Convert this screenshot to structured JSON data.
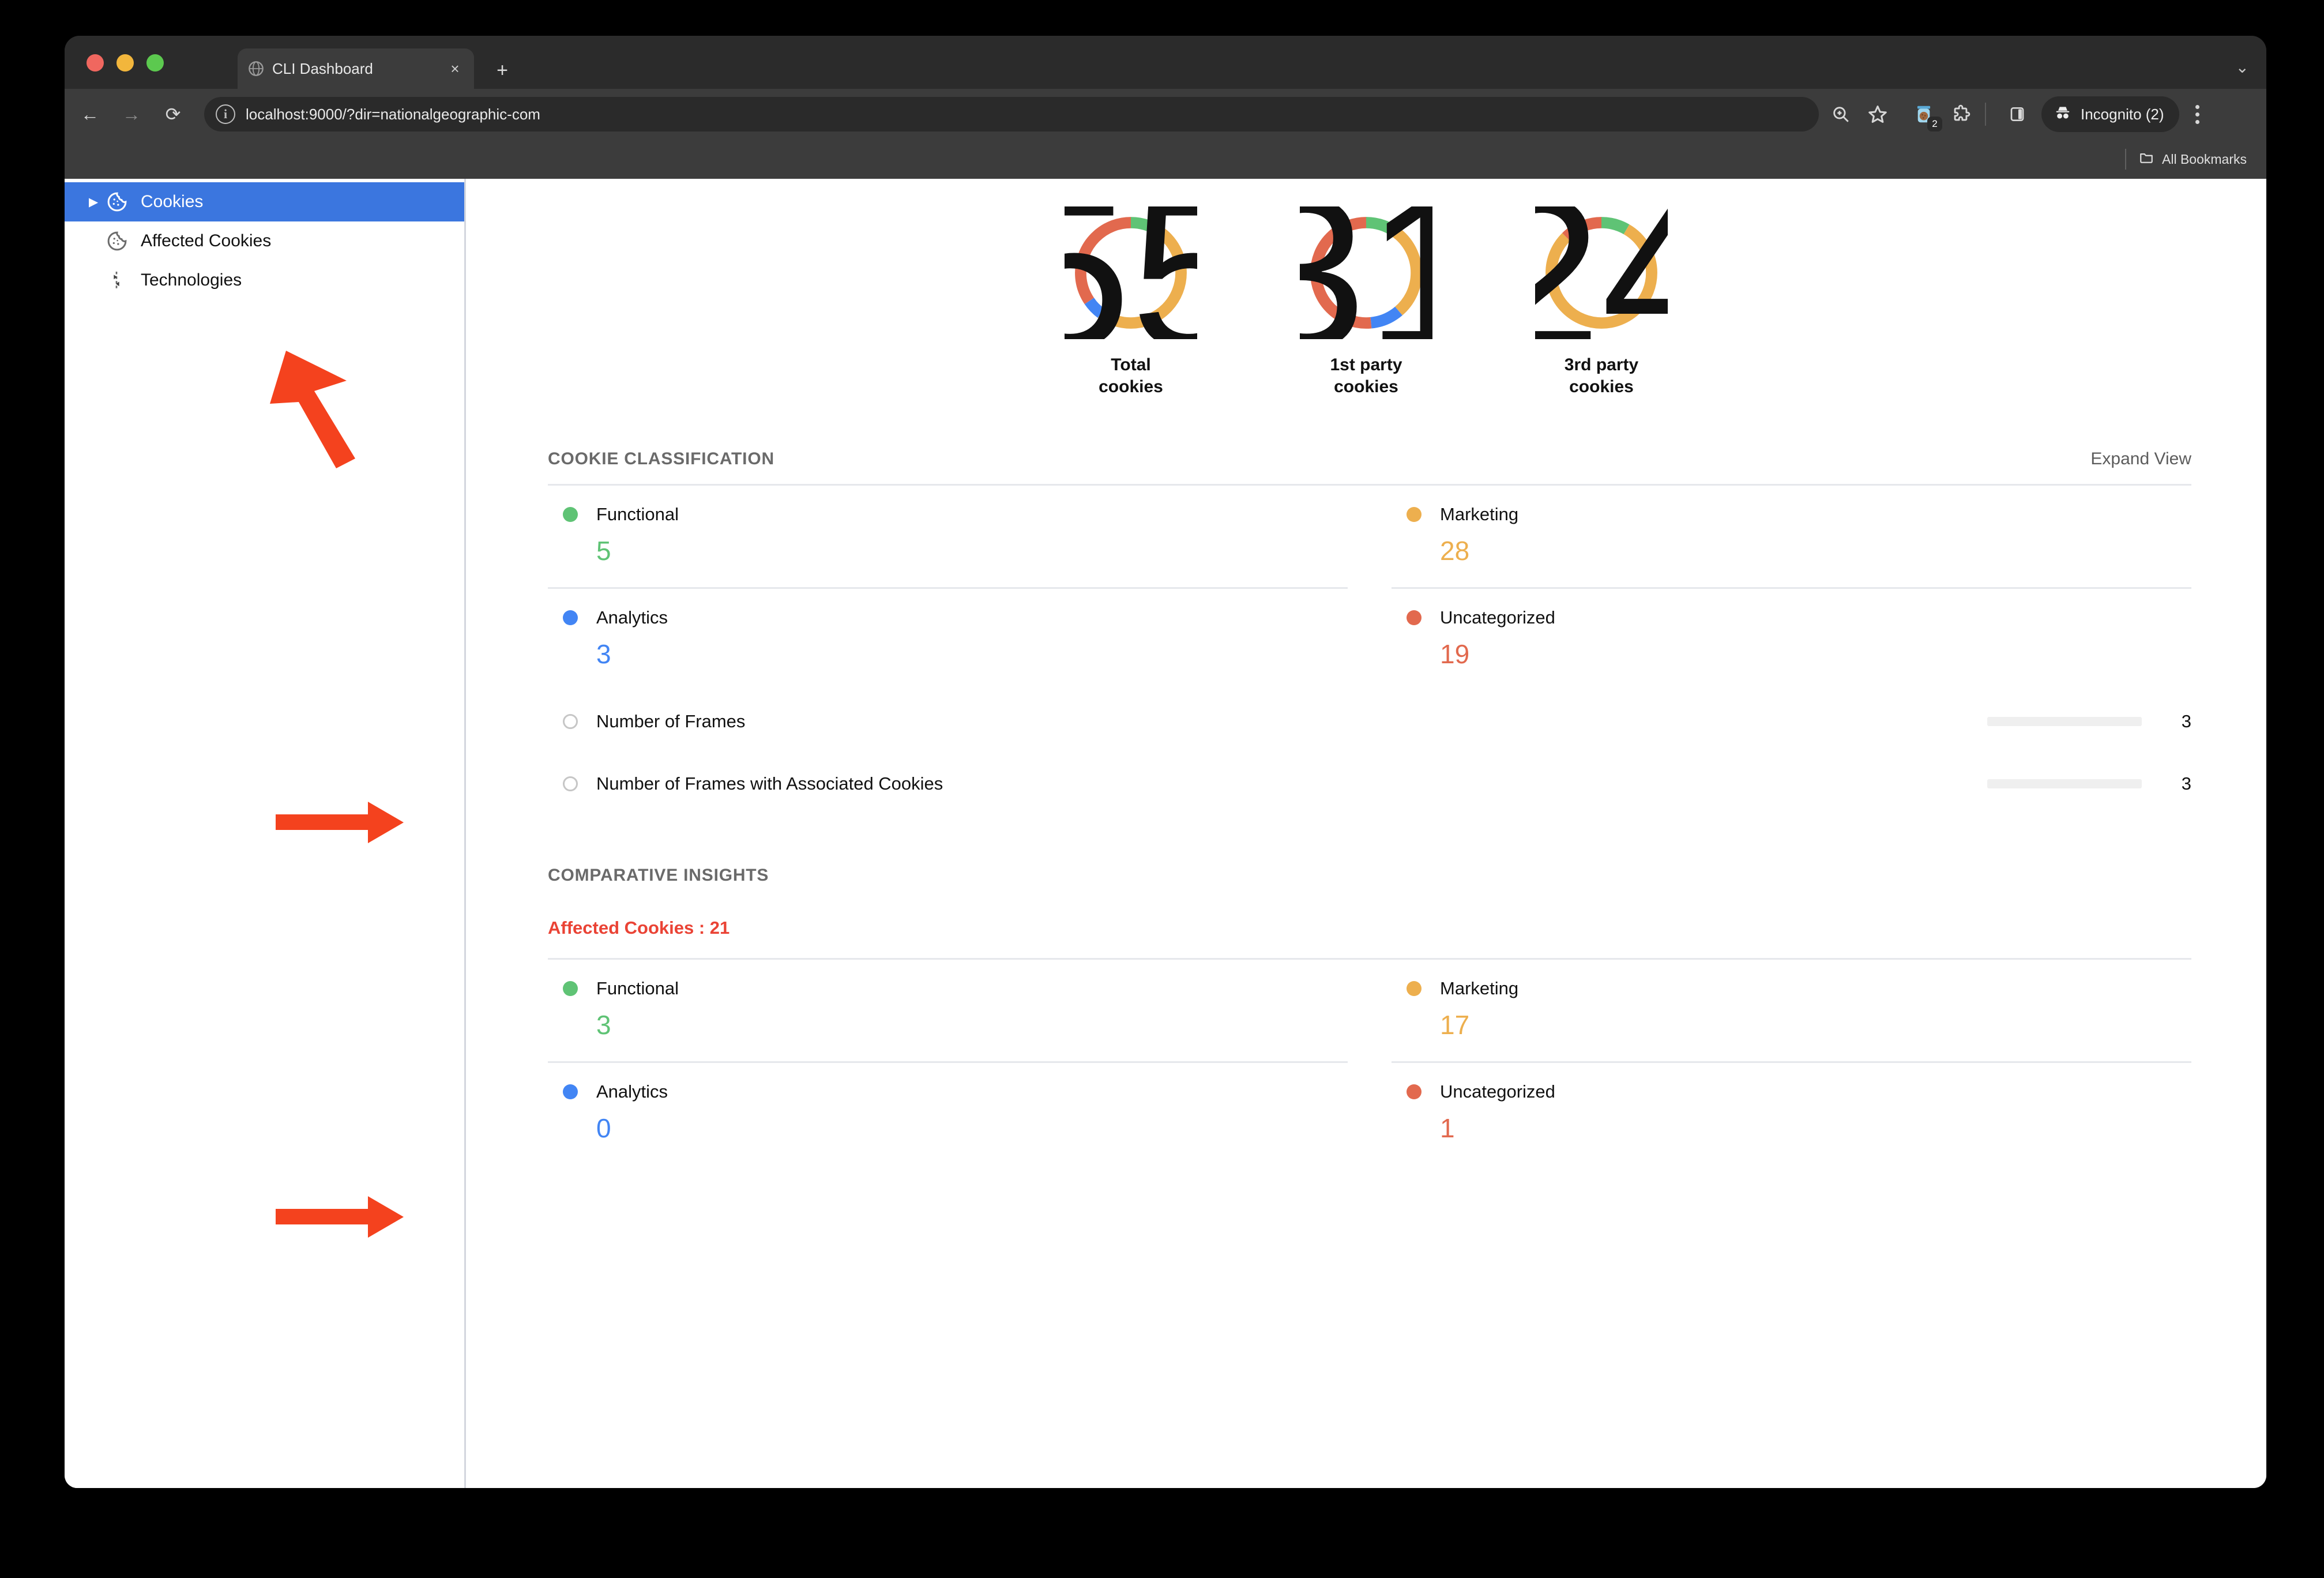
{
  "browser": {
    "tab": {
      "title": "CLI Dashboard",
      "favicon": "globe-icon",
      "close_label": "×"
    },
    "new_tab_label": "+",
    "window_chevron": "⌄",
    "nav": {
      "back": "←",
      "forward": "→",
      "reload": "⟳"
    },
    "omnibox": {
      "url": "localhost:9000/?dir=nationalgeographic-com",
      "info_glyph": "i"
    },
    "extension_badge": "2",
    "profile": {
      "label": "Incognito (2)"
    },
    "bookmarks": {
      "all_bookmarks_label": "All Bookmarks"
    }
  },
  "sidebar": {
    "items": [
      {
        "label": "Cookies",
        "icon": "cookie-icon",
        "selected": true,
        "caret": "▶"
      },
      {
        "label": "Affected Cookies",
        "icon": "cookie-icon",
        "selected": false
      },
      {
        "label": "Technologies",
        "icon": "technologies-icon",
        "selected": false
      }
    ]
  },
  "colors": {
    "functional": "#5FC375",
    "marketing": "#EDAF4E",
    "analytics": "#4285F4",
    "uncategorized": "#E2694E",
    "accent_blue": "#3B76DF",
    "affected_red": "#EA4335",
    "annotation": "#F4421E"
  },
  "chart_data": [
    {
      "type": "pie",
      "title": "Total cookies",
      "center_value": "55",
      "categories": [
        "Functional",
        "Marketing",
        "Analytics",
        "Uncategorized"
      ],
      "values": [
        5,
        28,
        3,
        19
      ],
      "colors": [
        "#5FC375",
        "#EDAF4E",
        "#4285F4",
        "#E2694E"
      ],
      "legend": "none",
      "donut": true
    },
    {
      "type": "pie",
      "title": "1st party cookies",
      "center_value": "31",
      "categories": [
        "Functional",
        "Marketing",
        "Analytics",
        "Uncategorized"
      ],
      "values": [
        3,
        9,
        3,
        16
      ],
      "colors": [
        "#5FC375",
        "#EDAF4E",
        "#4285F4",
        "#E2694E"
      ],
      "legend": "none",
      "donut": true
    },
    {
      "type": "pie",
      "title": "3rd party cookies",
      "center_value": "24",
      "categories": [
        "Functional",
        "Marketing",
        "Analytics",
        "Uncategorized"
      ],
      "values": [
        2,
        19,
        0,
        3
      ],
      "colors": [
        "#5FC375",
        "#EDAF4E",
        "#4285F4",
        "#E2694E"
      ],
      "legend": "none",
      "donut": true
    }
  ],
  "donuts": [
    {
      "value": "55",
      "label_line1": "Total",
      "label_line2": "cookies"
    },
    {
      "value": "31",
      "label_line1": "1st party",
      "label_line2": "cookies"
    },
    {
      "value": "24",
      "label_line1": "3rd party",
      "label_line2": "cookies"
    }
  ],
  "classification": {
    "title": "COOKIE CLASSIFICATION",
    "expand_label": "Expand View",
    "cells": [
      {
        "name": "Functional",
        "value": "5",
        "color": "#5FC375"
      },
      {
        "name": "Marketing",
        "value": "28",
        "color": "#EDAF4E"
      },
      {
        "name": "Analytics",
        "value": "3",
        "color": "#4285F4"
      },
      {
        "name": "Uncategorized",
        "value": "19",
        "color": "#E2694E"
      }
    ],
    "frames": [
      {
        "name": "Number of Frames",
        "count": "3"
      },
      {
        "name": "Number of Frames with Associated Cookies",
        "count": "3"
      }
    ]
  },
  "insights": {
    "title": "COMPARATIVE INSIGHTS",
    "affected_label": "Affected Cookies : 21",
    "cells": [
      {
        "name": "Functional",
        "value": "3",
        "color": "#5FC375"
      },
      {
        "name": "Marketing",
        "value": "17",
        "color": "#EDAF4E"
      },
      {
        "name": "Analytics",
        "value": "0",
        "color": "#4285F4"
      },
      {
        "name": "Uncategorized",
        "value": "1",
        "color": "#E2694E"
      }
    ]
  }
}
